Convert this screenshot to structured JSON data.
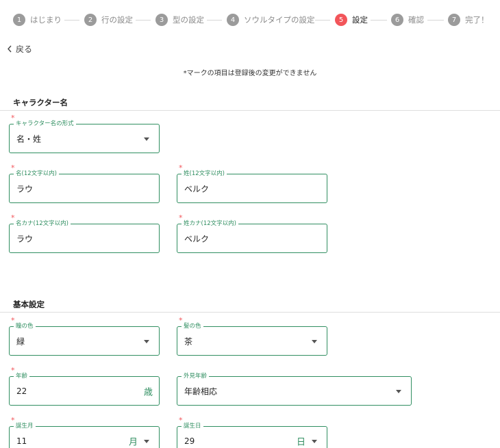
{
  "stepper": {
    "steps": [
      {
        "num": "1",
        "label": "はじまり"
      },
      {
        "num": "2",
        "label": "行の設定"
      },
      {
        "num": "3",
        "label": "型の設定"
      },
      {
        "num": "4",
        "label": "ソウルタイプの設定"
      },
      {
        "num": "5",
        "label": "設定"
      },
      {
        "num": "6",
        "label": "確認"
      },
      {
        "num": "7",
        "label": "完了！"
      }
    ],
    "active_step": "5"
  },
  "back": {
    "label": "戻る"
  },
  "notice": "*マークの項目は登録後の変更ができません",
  "sections": {
    "character_name": {
      "title": "キャラクター名"
    },
    "basic": {
      "title": "基本設定"
    }
  },
  "fields": {
    "name_format": {
      "legend": "キャラクター名の形式",
      "value": "名・姓",
      "required": "*"
    },
    "first_name": {
      "legend": "名(12文字以内)",
      "value": "ラウ",
      "required": "*"
    },
    "last_name": {
      "legend": "姓(12文字以内)",
      "value": "ベルク",
      "required": "*"
    },
    "first_kana": {
      "legend": "名カナ(12文字以内)",
      "value": "ラウ",
      "required": "*"
    },
    "last_kana": {
      "legend": "姓カナ(12文字以内)",
      "value": "ベルク",
      "required": "*"
    },
    "eye_color": {
      "legend": "瞳の色",
      "value": "緑",
      "required": "*"
    },
    "hair_color": {
      "legend": "髪の色",
      "value": "茶",
      "required": "*"
    },
    "age": {
      "legend": "年齢",
      "value": "22",
      "unit": "歳",
      "required": "*"
    },
    "apparent_age": {
      "legend": "外見年齢",
      "value": "年齢相応"
    },
    "birth_month": {
      "legend": "誕生月",
      "value": "11",
      "unit": "月",
      "required": "*"
    },
    "birth_day": {
      "legend": "誕生日",
      "value": "29",
      "unit": "日",
      "required": "*"
    }
  },
  "colors": {
    "accent": "#2f8e60",
    "active_step": "#f2555a",
    "required": "#f2555a"
  }
}
